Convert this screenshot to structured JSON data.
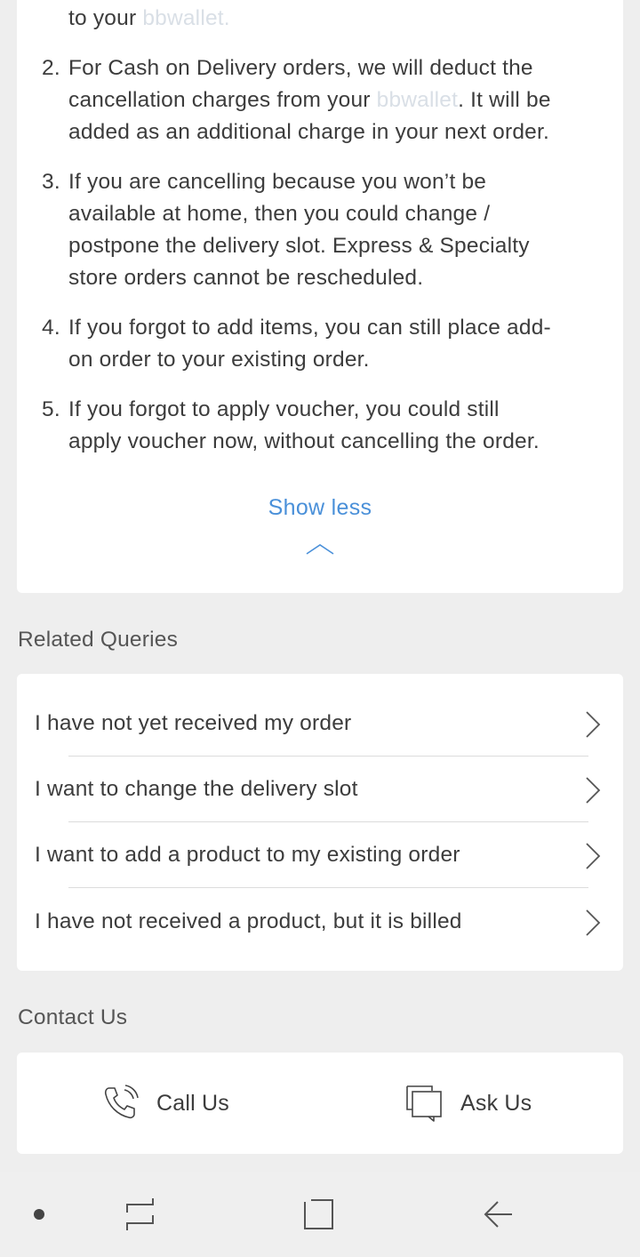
{
  "cancellation_notes": {
    "item1_tail": {
      "text": "to your ",
      "wallet": "bbwallet."
    },
    "items": [
      {
        "number": "2.",
        "line1": "For Cash on Delivery orders, we will deduct the",
        "line2_a": "cancellation charges from your ",
        "wallet": "bbwallet",
        "line2_b": ". It will be",
        "line3": "added as an additional charge in your next order."
      },
      {
        "number": "3.",
        "lines": [
          "If you are cancelling because you won’t be",
          "available at home, then you could change /",
          "postpone the delivery slot. Express & Specialty",
          "store orders cannot be rescheduled."
        ]
      },
      {
        "number": "4.",
        "lines": [
          "If you forgot to add items, you can still place add-",
          "on order to your existing order."
        ]
      },
      {
        "number": "5.",
        "lines": [
          "If you forgot to apply voucher, you could still",
          "apply voucher now, without cancelling the order."
        ]
      }
    ],
    "show_less_label": "Show less",
    "chevron_icon": "chevron-up-icon"
  },
  "related_queries": {
    "title": "Related Queries",
    "items": [
      {
        "label": "I have not yet received my order",
        "icon": "chevron-right-icon"
      },
      {
        "label": "I want to change the delivery slot",
        "icon": "chevron-right-icon"
      },
      {
        "label": "I want to add a product to my existing order",
        "icon": "chevron-right-icon"
      },
      {
        "label": "I have not received a product, but it is billed",
        "icon": "chevron-right-icon"
      }
    ]
  },
  "contact_us": {
    "title": "Contact Us",
    "call": {
      "label": "Call Us",
      "icon": "phone-icon"
    },
    "ask": {
      "label": "Ask Us",
      "icon": "chat-bubbles-icon"
    }
  },
  "system_nav": {
    "buttons": [
      "dot-icon",
      "recent-apps-icon",
      "home-icon",
      "back-icon"
    ]
  },
  "colors": {
    "accent_link": "#4a90d9",
    "faint_wallet": "#d9dfe6",
    "background": "#eeeeee"
  }
}
